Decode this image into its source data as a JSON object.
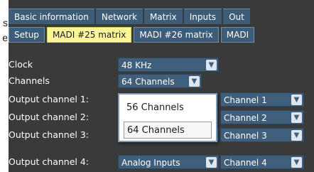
{
  "left_edge_chars": [
    "s",
    "e"
  ],
  "tabs": [
    "Basic information",
    "Network",
    "Matrix",
    "Inputs",
    "Out"
  ],
  "subtabs": [
    {
      "label": "Setup",
      "active": false
    },
    {
      "label": "MADI #25 matrix",
      "active": true
    },
    {
      "label": "MADI #26 matrix",
      "active": false
    },
    {
      "label": "MADI",
      "active": false
    }
  ],
  "settings": {
    "clock": {
      "label": "Clock",
      "value": "48 KHz"
    },
    "channels": {
      "label": "Channels",
      "value": "64 Channels"
    }
  },
  "outputs": [
    {
      "label": "Output channel 1:",
      "source": "",
      "channel": "Channel 1"
    },
    {
      "label": "Output channel 2:",
      "source": "",
      "channel": "Channel 2"
    },
    {
      "label": "Output channel 3:",
      "source": "",
      "channel": "Channel 3"
    },
    {
      "label": "Output channel 4:",
      "source": "Analog Inputs",
      "channel": "Channel 4"
    }
  ],
  "dropdown_options": [
    {
      "label": "56 Channels",
      "highlighted": false
    },
    {
      "label": "64 Channels",
      "highlighted": true
    }
  ],
  "chevron_glyph": "▼",
  "colors": {
    "panel": "#3a3a3a",
    "tab": "#3d5c78",
    "active_tab": "#fbf59a",
    "select": "#3f5f7c"
  }
}
